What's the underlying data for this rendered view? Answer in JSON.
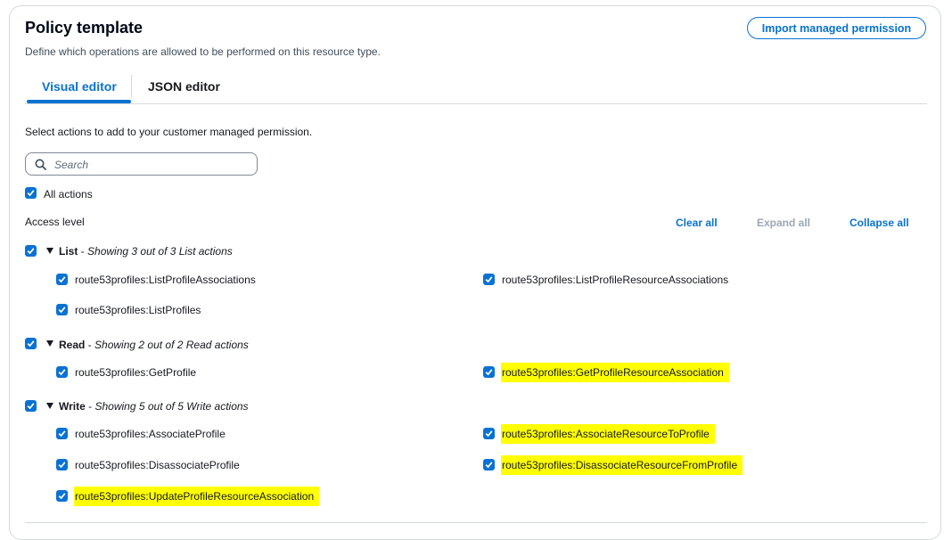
{
  "header": {
    "title": "Policy template",
    "description": "Define which operations are allowed to be performed on this resource type.",
    "import_button": "Import managed permission"
  },
  "tabs": [
    {
      "label": "Visual editor",
      "active": true
    },
    {
      "label": "JSON editor",
      "active": false
    }
  ],
  "instructions": "Select actions to add to your customer managed permission.",
  "search": {
    "placeholder": "Search",
    "value": ""
  },
  "all_actions": {
    "label": "All actions",
    "checked": true
  },
  "access_level": {
    "label": "Access level",
    "clear_all": "Clear all",
    "expand_all": "Expand all",
    "collapse_all": "Collapse all"
  },
  "groups": {
    "list": {
      "name": "List",
      "summary": "Showing 3 out of 3 List actions",
      "checked": true,
      "actions": [
        {
          "label": "route53profiles:ListProfileAssociations",
          "checked": true,
          "highlighted": false
        },
        {
          "label": "route53profiles:ListProfileResourceAssociations",
          "checked": true,
          "highlighted": false
        },
        {
          "label": "route53profiles:ListProfiles",
          "checked": true,
          "highlighted": false
        }
      ]
    },
    "read": {
      "name": "Read",
      "summary": "Showing 2 out of 2 Read actions",
      "checked": true,
      "actions": [
        {
          "label": "route53profiles:GetProfile",
          "checked": true,
          "highlighted": false
        },
        {
          "label": "route53profiles:GetProfileResourceAssociation",
          "checked": true,
          "highlighted": true
        }
      ]
    },
    "write": {
      "name": "Write",
      "summary": "Showing 5 out of 5 Write actions",
      "checked": true,
      "actions": [
        {
          "label": "route53profiles:AssociateProfile",
          "checked": true,
          "highlighted": false
        },
        {
          "label": "route53profiles:AssociateResourceToProfile",
          "checked": true,
          "highlighted": true
        },
        {
          "label": "route53profiles:DisassociateProfile",
          "checked": true,
          "highlighted": false
        },
        {
          "label": "route53profiles:DisassociateResourceFromProfile",
          "checked": true,
          "highlighted": true
        },
        {
          "label": "route53profiles:UpdateProfileResourceAssociation",
          "checked": true,
          "highlighted": true
        }
      ]
    }
  },
  "colors": {
    "accent": "#0972d3",
    "highlight": "#ffff00",
    "disabled": "#9ba7b6"
  }
}
